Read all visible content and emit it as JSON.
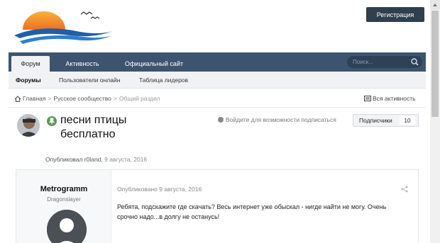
{
  "header": {
    "register_label": "Регистрация"
  },
  "nav": {
    "tabs": [
      {
        "label": "Форум"
      },
      {
        "label": "Активность"
      },
      {
        "label": "Официальный сайт"
      }
    ],
    "search_placeholder": "Поиск..."
  },
  "subnav": {
    "items": [
      {
        "label": "Форумы"
      },
      {
        "label": "Пользователи онлайн"
      },
      {
        "label": "Таблица лидеров"
      }
    ]
  },
  "breadcrumb": {
    "home": "Главная",
    "community": "Русское сообщество",
    "current": "Общий раздел",
    "all_activity": "Вся активность"
  },
  "topic": {
    "title": "песни птицы бесплатно",
    "posted_by_prefix": "Опубликовал",
    "author": "r0land,",
    "date": "9 августа, 2016",
    "follow_note": "Войдите для возможности подписаться",
    "subscribers_label": "Подписчики",
    "subscribers_count": "10"
  },
  "post": {
    "author_name": "Metrogramm",
    "author_rank": "Dragonslayer",
    "meta": "Опубликовано 9 августа, 2016",
    "body": "Ребята, подскажите где скачать? Весь интернет уже обыскал - нигде найти не могу. Очень срочно надо...в долгу не останусь!"
  },
  "colors": {
    "nav_bg": "#3d5470",
    "register_bg": "#2f3f4e",
    "pin_badge": "#5a9a54",
    "logo_sun": "#f39a2e",
    "logo_sea": "#1f5fa8"
  }
}
